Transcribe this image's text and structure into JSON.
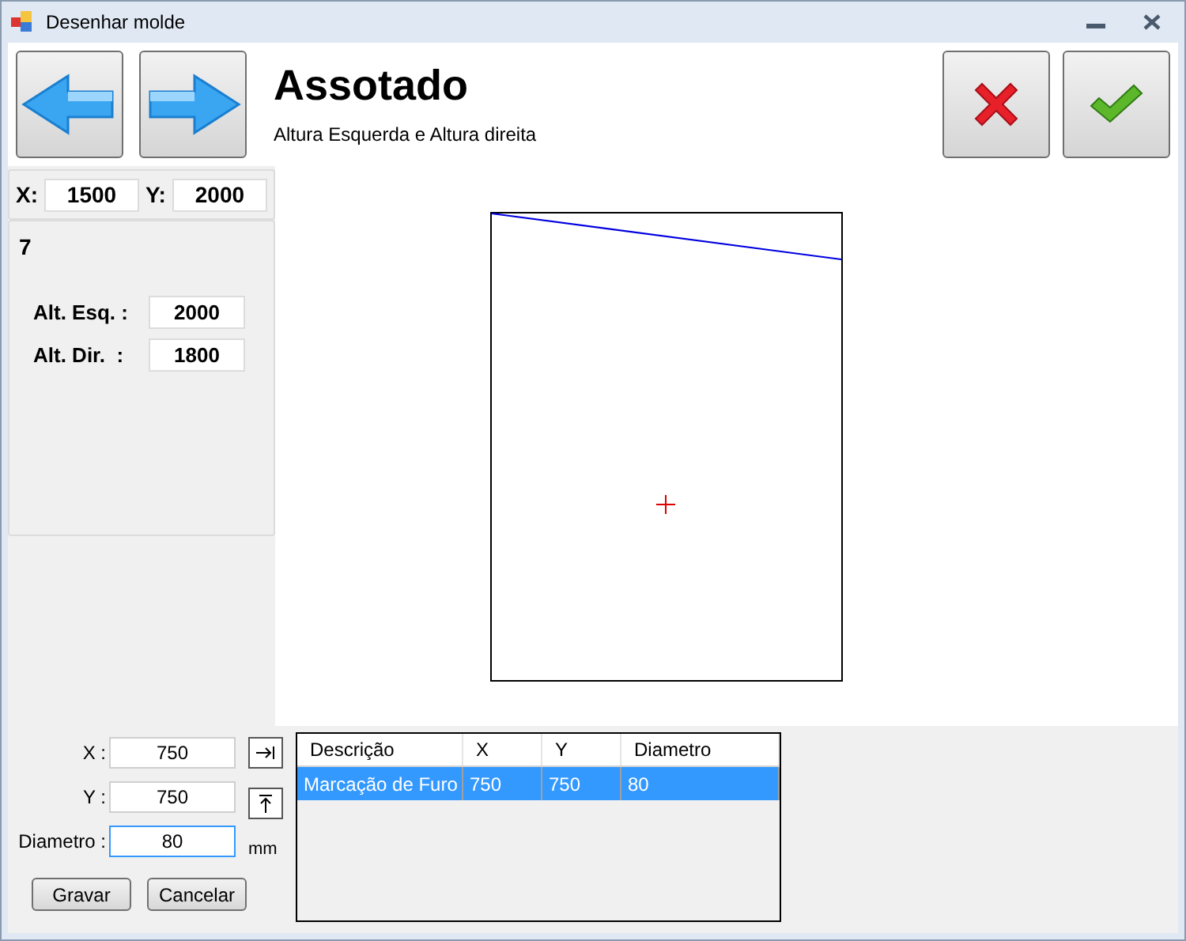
{
  "window": {
    "title": "Desenhar molde"
  },
  "header": {
    "title": "Assotado",
    "subtitle": "Altura Esquerda e Altura direita"
  },
  "coords": [
    {
      "label": "X:",
      "value": "1500"
    },
    {
      "label": "Y:",
      "value": "2000"
    }
  ],
  "panel": {
    "number": "7",
    "fields": [
      {
        "label": "Alt. Esq. :",
        "value": "2000"
      },
      {
        "label": "Alt. Dir.  :",
        "value": "1800"
      }
    ]
  },
  "hole_form": {
    "fields": [
      {
        "label": "X :",
        "value": "750",
        "kind": "align-right"
      },
      {
        "label": "Y :",
        "value": "750",
        "kind": "align-top"
      },
      {
        "label": "Diametro :",
        "value": "80",
        "kind": "unit",
        "unit": "mm",
        "focused": true
      }
    ],
    "buttons": [
      "Gravar",
      "Cancelar"
    ]
  },
  "table": {
    "columns": [
      "Descrição",
      "X",
      "Y",
      "Diametro"
    ],
    "rows": [
      {
        "cells": [
          "Marcação de Furo",
          "750",
          "750",
          "80"
        ],
        "selected": true
      }
    ]
  }
}
